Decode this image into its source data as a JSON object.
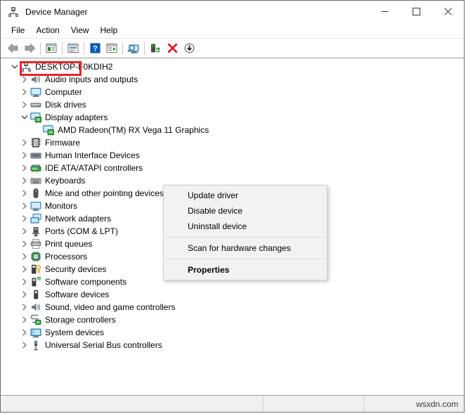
{
  "window": {
    "title": "Device Manager",
    "icon": "device-manager-icon",
    "controls": {
      "minimize": "─",
      "maximize": "☐",
      "close": "✕"
    }
  },
  "menubar": {
    "items": [
      {
        "label": "File"
      },
      {
        "label": "Action"
      },
      {
        "label": "View"
      },
      {
        "label": "Help"
      }
    ]
  },
  "toolbar": {
    "buttons": [
      {
        "name": "back-button",
        "icon": "back-arrow-icon"
      },
      {
        "name": "forward-button",
        "icon": "forward-arrow-icon"
      },
      {
        "name": "separator-1",
        "icon": "separator"
      },
      {
        "name": "show-hide-console-tree-button",
        "icon": "console-tree-icon"
      },
      {
        "name": "separator-2",
        "icon": "separator"
      },
      {
        "name": "properties-button",
        "icon": "properties-window-icon"
      },
      {
        "name": "separator-3",
        "icon": "separator"
      },
      {
        "name": "help-button",
        "icon": "help-question-icon"
      },
      {
        "name": "action-menu-button",
        "icon": "action-list-icon"
      },
      {
        "name": "separator-4",
        "icon": "separator"
      },
      {
        "name": "scan-for-hardware-changes-button",
        "icon": "scan-monitor-icon"
      },
      {
        "name": "separator-5",
        "icon": "separator"
      },
      {
        "name": "update-driver-button",
        "icon": "update-driver-icon"
      },
      {
        "name": "uninstall-device-button",
        "icon": "red-x-icon"
      },
      {
        "name": "disable-device-button",
        "icon": "down-arrow-circle-icon"
      }
    ]
  },
  "tree": {
    "root": {
      "label": "DESKTOP-F0KDIH2",
      "icon": "computer-root-icon",
      "expanded": true,
      "twisty": "expanded"
    },
    "nodes": [
      {
        "label": "Audio inputs and outputs",
        "icon": "speaker-icon",
        "twisty": "collapsed",
        "level": 1
      },
      {
        "label": "Computer",
        "icon": "monitor-icon",
        "twisty": "collapsed",
        "level": 1
      },
      {
        "label": "Disk drives",
        "icon": "disk-drive-icon",
        "twisty": "collapsed",
        "level": 1
      },
      {
        "label": "Display adapters",
        "icon": "display-adapter-icon",
        "twisty": "expanded",
        "level": 1
      },
      {
        "label": "AMD Radeon(TM) RX Vega 11 Graphics",
        "icon": "display-adapter-icon",
        "twisty": "none",
        "level": 2,
        "selected": true
      },
      {
        "label": "Firmware",
        "icon": "firmware-icon",
        "twisty": "collapsed",
        "level": 1
      },
      {
        "label": "Human Interface Devices",
        "icon": "hid-icon",
        "twisty": "collapsed",
        "level": 1
      },
      {
        "label": "IDE ATA/ATAPI controllers",
        "icon": "ide-controller-icon",
        "twisty": "collapsed",
        "level": 1
      },
      {
        "label": "Keyboards",
        "icon": "keyboard-icon",
        "twisty": "collapsed",
        "level": 1
      },
      {
        "label": "Mice and other pointing devices",
        "icon": "mouse-icon",
        "twisty": "collapsed",
        "level": 1
      },
      {
        "label": "Monitors",
        "icon": "monitor-icon",
        "twisty": "collapsed",
        "level": 1
      },
      {
        "label": "Network adapters",
        "icon": "network-adapter-icon",
        "twisty": "collapsed",
        "level": 1
      },
      {
        "label": "Ports (COM & LPT)",
        "icon": "port-icon",
        "twisty": "collapsed",
        "level": 1
      },
      {
        "label": "Print queues",
        "icon": "printer-icon",
        "twisty": "collapsed",
        "level": 1
      },
      {
        "label": "Processors",
        "icon": "processor-icon",
        "twisty": "collapsed",
        "level": 1
      },
      {
        "label": "Security devices",
        "icon": "security-device-icon",
        "twisty": "collapsed",
        "level": 1
      },
      {
        "label": "Software components",
        "icon": "software-component-icon",
        "twisty": "collapsed",
        "level": 1
      },
      {
        "label": "Software devices",
        "icon": "software-device-icon",
        "twisty": "collapsed",
        "level": 1
      },
      {
        "label": "Sound, video and game controllers",
        "icon": "speaker-icon",
        "twisty": "collapsed",
        "level": 1
      },
      {
        "label": "Storage controllers",
        "icon": "storage-controller-icon",
        "twisty": "collapsed",
        "level": 1
      },
      {
        "label": "System devices",
        "icon": "system-device-icon",
        "twisty": "collapsed",
        "level": 1
      },
      {
        "label": "Universal Serial Bus controllers",
        "icon": "usb-icon",
        "twisty": "collapsed",
        "level": 1
      }
    ]
  },
  "context_menu": {
    "items": [
      {
        "label": "Update driver",
        "bold": false,
        "highlighted": true
      },
      {
        "label": "Disable device",
        "bold": false
      },
      {
        "label": "Uninstall device",
        "bold": false
      },
      {
        "separator": true
      },
      {
        "label": "Scan for hardware changes",
        "bold": false
      },
      {
        "separator": true
      },
      {
        "label": "Properties",
        "bold": true
      }
    ],
    "highlight_color": "#e8262a"
  },
  "statusbar": {
    "pane1": "",
    "pane2": "",
    "watermark": "wsxdn.com"
  }
}
